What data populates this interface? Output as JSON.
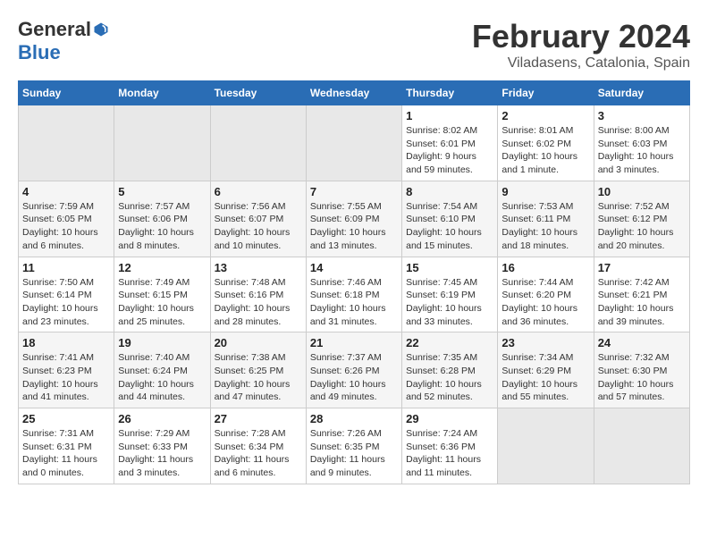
{
  "logo": {
    "general": "General",
    "blue": "Blue"
  },
  "title": "February 2024",
  "subtitle": "Viladasens, Catalonia, Spain",
  "days_header": [
    "Sunday",
    "Monday",
    "Tuesday",
    "Wednesday",
    "Thursday",
    "Friday",
    "Saturday"
  ],
  "weeks": [
    [
      {
        "day": "",
        "empty": true
      },
      {
        "day": "",
        "empty": true
      },
      {
        "day": "",
        "empty": true
      },
      {
        "day": "",
        "empty": true
      },
      {
        "day": "1",
        "sunrise": "8:02 AM",
        "sunset": "6:01 PM",
        "daylight": "9 hours and 59 minutes."
      },
      {
        "day": "2",
        "sunrise": "8:01 AM",
        "sunset": "6:02 PM",
        "daylight": "10 hours and 1 minute."
      },
      {
        "day": "3",
        "sunrise": "8:00 AM",
        "sunset": "6:03 PM",
        "daylight": "10 hours and 3 minutes."
      }
    ],
    [
      {
        "day": "4",
        "sunrise": "7:59 AM",
        "sunset": "6:05 PM",
        "daylight": "10 hours and 6 minutes."
      },
      {
        "day": "5",
        "sunrise": "7:57 AM",
        "sunset": "6:06 PM",
        "daylight": "10 hours and 8 minutes."
      },
      {
        "day": "6",
        "sunrise": "7:56 AM",
        "sunset": "6:07 PM",
        "daylight": "10 hours and 10 minutes."
      },
      {
        "day": "7",
        "sunrise": "7:55 AM",
        "sunset": "6:09 PM",
        "daylight": "10 hours and 13 minutes."
      },
      {
        "day": "8",
        "sunrise": "7:54 AM",
        "sunset": "6:10 PM",
        "daylight": "10 hours and 15 minutes."
      },
      {
        "day": "9",
        "sunrise": "7:53 AM",
        "sunset": "6:11 PM",
        "daylight": "10 hours and 18 minutes."
      },
      {
        "day": "10",
        "sunrise": "7:52 AM",
        "sunset": "6:12 PM",
        "daylight": "10 hours and 20 minutes."
      }
    ],
    [
      {
        "day": "11",
        "sunrise": "7:50 AM",
        "sunset": "6:14 PM",
        "daylight": "10 hours and 23 minutes."
      },
      {
        "day": "12",
        "sunrise": "7:49 AM",
        "sunset": "6:15 PM",
        "daylight": "10 hours and 25 minutes."
      },
      {
        "day": "13",
        "sunrise": "7:48 AM",
        "sunset": "6:16 PM",
        "daylight": "10 hours and 28 minutes."
      },
      {
        "day": "14",
        "sunrise": "7:46 AM",
        "sunset": "6:18 PM",
        "daylight": "10 hours and 31 minutes."
      },
      {
        "day": "15",
        "sunrise": "7:45 AM",
        "sunset": "6:19 PM",
        "daylight": "10 hours and 33 minutes."
      },
      {
        "day": "16",
        "sunrise": "7:44 AM",
        "sunset": "6:20 PM",
        "daylight": "10 hours and 36 minutes."
      },
      {
        "day": "17",
        "sunrise": "7:42 AM",
        "sunset": "6:21 PM",
        "daylight": "10 hours and 39 minutes."
      }
    ],
    [
      {
        "day": "18",
        "sunrise": "7:41 AM",
        "sunset": "6:23 PM",
        "daylight": "10 hours and 41 minutes."
      },
      {
        "day": "19",
        "sunrise": "7:40 AM",
        "sunset": "6:24 PM",
        "daylight": "10 hours and 44 minutes."
      },
      {
        "day": "20",
        "sunrise": "7:38 AM",
        "sunset": "6:25 PM",
        "daylight": "10 hours and 47 minutes."
      },
      {
        "day": "21",
        "sunrise": "7:37 AM",
        "sunset": "6:26 PM",
        "daylight": "10 hours and 49 minutes."
      },
      {
        "day": "22",
        "sunrise": "7:35 AM",
        "sunset": "6:28 PM",
        "daylight": "10 hours and 52 minutes."
      },
      {
        "day": "23",
        "sunrise": "7:34 AM",
        "sunset": "6:29 PM",
        "daylight": "10 hours and 55 minutes."
      },
      {
        "day": "24",
        "sunrise": "7:32 AM",
        "sunset": "6:30 PM",
        "daylight": "10 hours and 57 minutes."
      }
    ],
    [
      {
        "day": "25",
        "sunrise": "7:31 AM",
        "sunset": "6:31 PM",
        "daylight": "11 hours and 0 minutes."
      },
      {
        "day": "26",
        "sunrise": "7:29 AM",
        "sunset": "6:33 PM",
        "daylight": "11 hours and 3 minutes."
      },
      {
        "day": "27",
        "sunrise": "7:28 AM",
        "sunset": "6:34 PM",
        "daylight": "11 hours and 6 minutes."
      },
      {
        "day": "28",
        "sunrise": "7:26 AM",
        "sunset": "6:35 PM",
        "daylight": "11 hours and 9 minutes."
      },
      {
        "day": "29",
        "sunrise": "7:24 AM",
        "sunset": "6:36 PM",
        "daylight": "11 hours and 11 minutes."
      },
      {
        "day": "",
        "empty": true
      },
      {
        "day": "",
        "empty": true
      }
    ]
  ],
  "labels": {
    "sunrise": "Sunrise:",
    "sunset": "Sunset:",
    "daylight": "Daylight:"
  }
}
